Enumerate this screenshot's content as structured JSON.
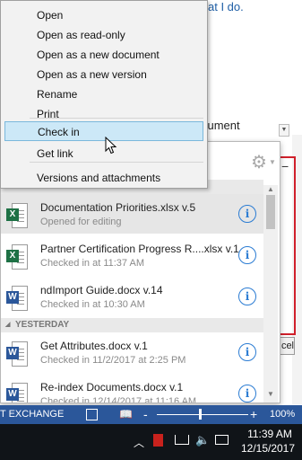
{
  "background": {
    "link_text": "at I do.",
    "partial_text": "cument",
    "cancel_label": "cel"
  },
  "context_menu": {
    "items": [
      {
        "label": "Open"
      },
      {
        "label": "Open as read-only"
      },
      {
        "label": "Open as a new document"
      },
      {
        "label": "Open as a new version"
      },
      {
        "label": "Rename"
      },
      {
        "label": "Print"
      },
      {
        "label": "Check in",
        "highlighted": true
      },
      {
        "label": "Get link"
      },
      {
        "label": "Versions and attachments"
      }
    ]
  },
  "panel": {
    "settings_icon": "gear-icon",
    "sections": [
      {
        "label": "TODAY",
        "files": [
          {
            "name": "Documentation Priorities.xlsx v.5",
            "status": "Opened for editing",
            "type": "excel",
            "badge": "X"
          },
          {
            "name": "Partner Certification Progress R....xlsx v.1",
            "status": "Checked in at 11:37 AM",
            "type": "excel",
            "badge": "X"
          },
          {
            "name": "ndImport Guide.docx v.14",
            "status": "Checked in at 10:30 AM",
            "type": "word",
            "badge": "W"
          }
        ]
      },
      {
        "label": "YESTERDAY",
        "files": [
          {
            "name": "Get Attributes.docx v.1",
            "status": "Checked in 11/2/2017 at 2:25 PM",
            "type": "word",
            "badge": "W"
          },
          {
            "name": "Re-index Documents.docx v.1",
            "status": "Checked in 12/14/2017 at 11:16 AM",
            "type": "word",
            "badge": "W"
          }
        ]
      }
    ]
  },
  "statusbar": {
    "text": "T EXCHANGE",
    "zoom_minus": "-",
    "zoom_plus": "+",
    "zoom_level": "100%",
    "zoom_fraction": 0.48
  },
  "taskbar": {
    "time": "11:39 AM",
    "date": "12/15/2017"
  }
}
